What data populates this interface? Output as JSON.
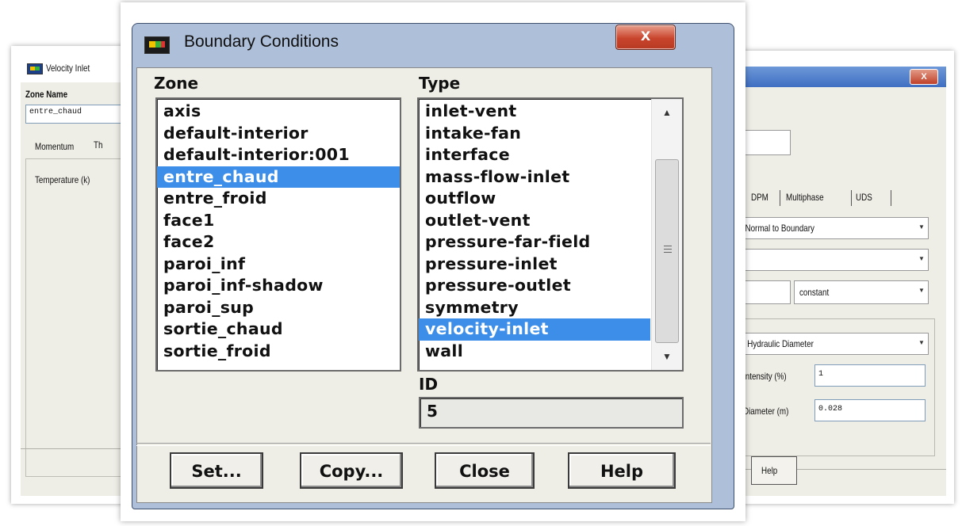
{
  "left_window": {
    "title": "Velocity Inlet",
    "zone_name_label": "Zone Name",
    "zone_name_value": "entre_chaud",
    "tab_momentum": "Momentum",
    "tab_thermal_partial": "Th",
    "temperature_label": "Temperature (k)"
  },
  "right_window": {
    "close_glyph": "X",
    "tabs": [
      "s",
      "DPM",
      "Multiphase",
      "UDS"
    ],
    "direction_method": ", Normal to Boundary",
    "profile_option": "constant",
    "turbulence_spec": "d Hydraulic Diameter",
    "intensity_label": "Intensity (%)",
    "intensity_value": "1",
    "diameter_label": "Diameter (m)",
    "diameter_value": "0.028",
    "help_button": "Help"
  },
  "dialog": {
    "title": "Boundary Conditions",
    "close_glyph": "X",
    "zone_label": "Zone",
    "type_label": "Type",
    "zones": [
      "axis",
      "default-interior",
      "default-interior:001",
      "entre_chaud",
      "entre_froid",
      "face1",
      "face2",
      "paroi_inf",
      "paroi_inf-shadow",
      "paroi_sup",
      "sortie_chaud",
      "sortie_froid"
    ],
    "selected_zone": "entre_chaud",
    "types": [
      "inlet-vent",
      "intake-fan",
      "interface",
      "mass-flow-inlet",
      "outflow",
      "outlet-vent",
      "pressure-far-field",
      "pressure-inlet",
      "pressure-outlet",
      "symmetry",
      "velocity-inlet",
      "wall"
    ],
    "selected_type": "velocity-inlet",
    "id_label": "ID",
    "id_value": "5",
    "buttons": {
      "set": "Set...",
      "copy": "Copy...",
      "close": "Close",
      "help": "Help"
    }
  },
  "colors": {
    "selection": "#3d8ee8",
    "client_bg": "#eeede6",
    "frame": "#aebfd9",
    "close_button": "#c8442c"
  },
  "icons": {
    "app": "fluent-app-icon",
    "scroll_up": "triangle-up",
    "scroll_down": "triangle-down"
  }
}
